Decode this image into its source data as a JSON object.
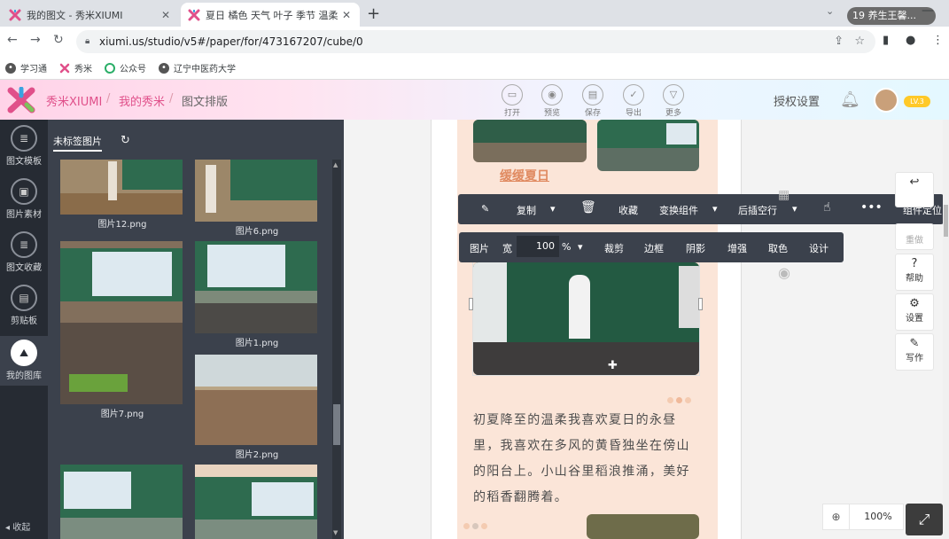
{
  "browser": {
    "tabs": [
      {
        "title": "我的图文 - 秀米XIUMI",
        "close": "✕"
      },
      {
        "title": "夏日 橘色 天气 叶子 季节 温柔",
        "close": "✕"
      }
    ],
    "new_tab": "+",
    "tab_search": "⌄",
    "profile": "19 养生王馨...",
    "minimize": "—",
    "url": "xiumi.us/studio/v5#/paper/for/473167207/cube/0",
    "bookmarks": [
      {
        "label": "学习通",
        "icon": "globe-icon"
      },
      {
        "label": "秀米",
        "icon": "xiumi-icon"
      },
      {
        "label": "公众号",
        "icon": "wechat-icon"
      },
      {
        "label": "辽宁中医药大学",
        "icon": "globe-icon"
      }
    ]
  },
  "app": {
    "brand": "秀米XIUMI",
    "crumbs": [
      "我的秀米",
      "图文排版"
    ],
    "separator": "/",
    "toolbar": [
      {
        "label": "打开",
        "glyph": "▭"
      },
      {
        "label": "预览",
        "glyph": "◉"
      },
      {
        "label": "保存",
        "glyph": "▤"
      },
      {
        "label": "导出",
        "glyph": "✓"
      },
      {
        "label": "更多",
        "glyph": "▽"
      }
    ],
    "auth_settings": "授权设置",
    "level": "LV.3",
    "accent": "#e0508a"
  },
  "left_nav": {
    "items": [
      {
        "label": "图文模板",
        "glyph": "≣"
      },
      {
        "label": "图片素材",
        "glyph": "▣"
      },
      {
        "label": "图文收藏",
        "glyph": "≣"
      },
      {
        "label": "剪贴板",
        "glyph": "▤"
      },
      {
        "label": "我的图库",
        "glyph": "⛰"
      }
    ],
    "collapse": "◂ 收起"
  },
  "library": {
    "tab": "未标签图片",
    "refresh": "↻",
    "items": [
      {
        "caption": "图片12.png"
      },
      {
        "caption": "图片6.png"
      },
      {
        "caption": "图片1.png"
      },
      {
        "caption": "图片7.png"
      },
      {
        "caption": "图片2.png"
      },
      {
        "caption": ""
      },
      {
        "caption": ""
      }
    ]
  },
  "editor": {
    "heading": "缓缓夏日",
    "paragraph": "初夏降至的温柔我喜欢夏日的永昼里，我喜欢在多风的黄昏独坐在傍山的阳台上。小山谷里稻浪推涌，美好的稻香翻腾着。",
    "toolbar1": {
      "pin": "✎",
      "copy": "复制",
      "copy_arrow": "▾",
      "trash": "🗑",
      "collect": "收藏",
      "transform": "变换组件",
      "transform_arrow": "▾",
      "insert_after": "后插空行",
      "insert_arrow": "▾",
      "cursor": "☝",
      "more": "•••",
      "locate": "组件定位"
    },
    "toolbar2": {
      "label": "图片",
      "width_label": "宽",
      "width_value": "100",
      "unit": "%",
      "unit_arrow": "▾",
      "crop": "裁剪",
      "border": "边框",
      "shadow": "阴影",
      "enhance": "增强",
      "pick_color": "取色",
      "design": "设计"
    }
  },
  "right_panel": {
    "undo_glyph": "↩",
    "redo": "重做",
    "help": "帮助",
    "help_glyph": "?",
    "settings": "设置",
    "settings_glyph": "⚙",
    "write": "写作",
    "write_glyph": "✎",
    "eye_glyph": "◉",
    "zoom_icon": "⊕",
    "zoom": "100%",
    "expand_glyph": "⤢"
  }
}
